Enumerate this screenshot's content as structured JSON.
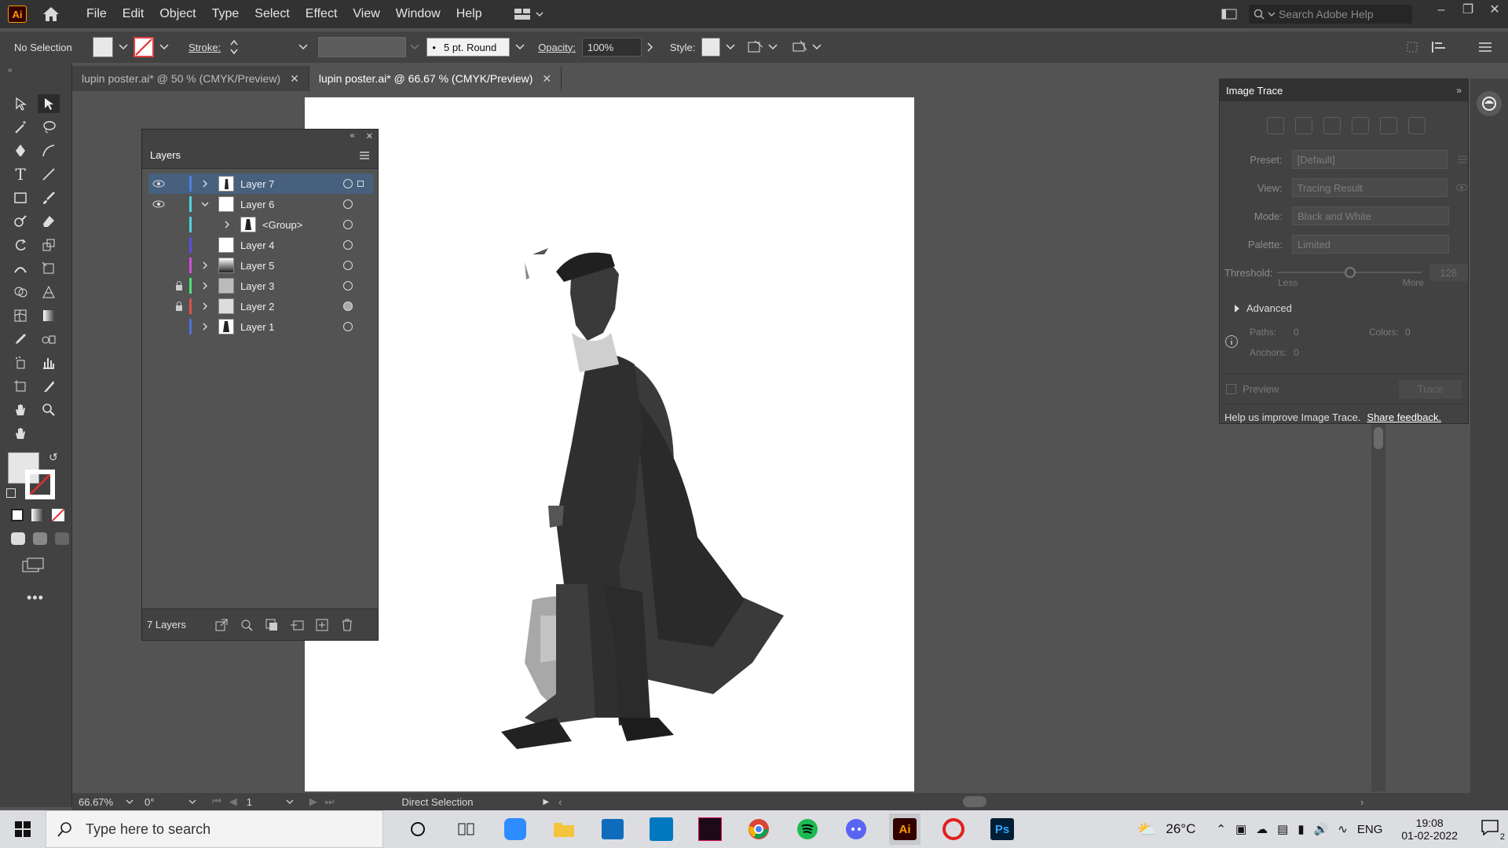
{
  "app": {
    "logo": "Ai",
    "menus": [
      "File",
      "Edit",
      "Object",
      "Type",
      "Select",
      "Effect",
      "View",
      "Window",
      "Help"
    ],
    "search_placeholder": "Search Adobe Help"
  },
  "control": {
    "selection": "No Selection",
    "stroke_label": "Stroke:",
    "brush": "5 pt. Round",
    "opacity_label": "Opacity:",
    "opacity_value": "100%",
    "style_label": "Style:"
  },
  "tabs": [
    {
      "label": "lupin poster.ai* @ 50 % (CMYK/Preview)"
    },
    {
      "label": "lupin poster.ai* @ 66.67 % (CMYK/Preview)"
    }
  ],
  "layers": {
    "title": "Layers",
    "count": "7 Layers",
    "rows": [
      {
        "name": "Layer 7",
        "color": "#4f7fe0",
        "visible": true,
        "locked": false
      },
      {
        "name": "Layer 6",
        "color": "#4fd3e0",
        "visible": true,
        "locked": false
      },
      {
        "name": "<Group>",
        "color": "#4fd3e0",
        "visible": false,
        "locked": false
      },
      {
        "name": "Layer 4",
        "color": "#5a4fe0",
        "visible": false,
        "locked": false
      },
      {
        "name": "Layer 5",
        "color": "#d04fe0",
        "visible": false,
        "locked": false
      },
      {
        "name": "Layer 3",
        "color": "#4fe07a",
        "visible": false,
        "locked": true
      },
      {
        "name": "Layer 2",
        "color": "#e04f4f",
        "visible": false,
        "locked": true
      },
      {
        "name": "Layer 1",
        "color": "#4f6fe0",
        "visible": false,
        "locked": false
      }
    ]
  },
  "trace": {
    "title": "Image Trace",
    "preset_label": "Preset:",
    "preset_value": "[Default]",
    "view_label": "View:",
    "view_value": "Tracing Result",
    "mode_label": "Mode:",
    "mode_value": "Black and White",
    "palette_label": "Palette:",
    "palette_value": "Limited",
    "threshold_label": "Threshold:",
    "threshold_value": "128",
    "less": "Less",
    "more": "More",
    "advanced": "Advanced",
    "paths_label": "Paths:",
    "paths_value": "0",
    "colors_label": "Colors:",
    "colors_value": "0",
    "anchors_label": "Anchors:",
    "anchors_value": "0",
    "preview": "Preview",
    "trace_btn": "Trace",
    "help_text": "Help us improve Image Trace.",
    "feedback": "Share feedback."
  },
  "status": {
    "zoom": "66.67%",
    "rotation": "0°",
    "artboard": "1",
    "tool": "Direct Selection"
  },
  "taskbar": {
    "search_placeholder": "Type here to search",
    "temp": "26°C",
    "lang": "ENG",
    "time": "19:08",
    "date": "01-02-2022",
    "notifications": "2"
  }
}
